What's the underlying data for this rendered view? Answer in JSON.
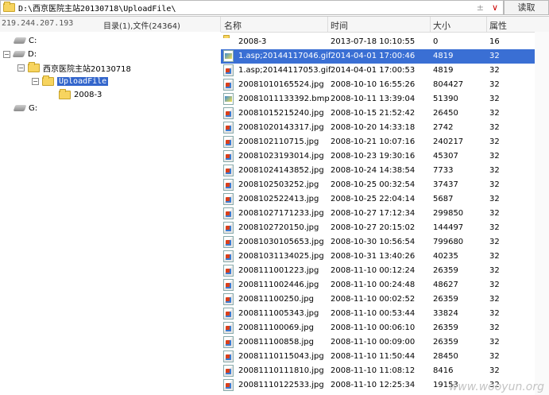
{
  "path_bar": {
    "path": "D:\\西京医院主站20130718\\UploadFile\\",
    "ctrl_plus": "±",
    "ctrl_dropdown": "∨",
    "read_button": "读取"
  },
  "status": {
    "ip": "219.244.207.193",
    "dir_info": "目录(1),文件(24364)"
  },
  "tree": {
    "nodes": [
      {
        "label": "C:",
        "type": "drive"
      },
      {
        "label": "D:",
        "type": "drive"
      },
      {
        "label": "西京医院主站20130718",
        "type": "folder"
      },
      {
        "label": "UploadFile",
        "type": "folder"
      },
      {
        "label": "2008-3",
        "type": "folder"
      },
      {
        "label": "G:",
        "type": "drive"
      }
    ],
    "expanders": [
      "⊟",
      "⊟",
      "⊟"
    ]
  },
  "file_list": {
    "columns": {
      "name": "名称",
      "time": "时间",
      "size": "大小",
      "attr": "属性"
    },
    "rows": [
      {
        "name": "2008-3",
        "time": "2013-07-18 10:10:55",
        "size": "0",
        "attr": "16",
        "icon": "folder"
      },
      {
        "name": "1.asp;20144117046.gif",
        "time": "2014-04-01 17:00:46",
        "size": "4819",
        "attr": "32",
        "icon": "bmp",
        "selected": true
      },
      {
        "name": "1.asp;20144117053.gif",
        "time": "2014-04-01 17:00:53",
        "size": "4819",
        "attr": "32",
        "icon": "image"
      },
      {
        "name": "20081010165524.jpg",
        "time": "2008-10-10 16:55:26",
        "size": "804427",
        "attr": "32",
        "icon": "image"
      },
      {
        "name": "20081011133392.bmp",
        "time": "2008-10-11 13:39:04",
        "size": "51390",
        "attr": "32",
        "icon": "bmp"
      },
      {
        "name": "20081015215240.jpg",
        "time": "2008-10-15 21:52:42",
        "size": "26450",
        "attr": "32",
        "icon": "image"
      },
      {
        "name": "20081020143317.jpg",
        "time": "2008-10-20 14:33:18",
        "size": "2742",
        "attr": "32",
        "icon": "image"
      },
      {
        "name": "2008102110715.jpg",
        "time": "2008-10-21 10:07:16",
        "size": "240217",
        "attr": "32",
        "icon": "image"
      },
      {
        "name": "20081023193014.jpg",
        "time": "2008-10-23 19:30:16",
        "size": "45307",
        "attr": "32",
        "icon": "image"
      },
      {
        "name": "20081024143852.jpg",
        "time": "2008-10-24 14:38:54",
        "size": "7733",
        "attr": "32",
        "icon": "image"
      },
      {
        "name": "2008102503252.jpg",
        "time": "2008-10-25 00:32:54",
        "size": "37437",
        "attr": "32",
        "icon": "image"
      },
      {
        "name": "2008102522413.jpg",
        "time": "2008-10-25 22:04:14",
        "size": "5687",
        "attr": "32",
        "icon": "image"
      },
      {
        "name": "20081027171233.jpg",
        "time": "2008-10-27 17:12:34",
        "size": "299850",
        "attr": "32",
        "icon": "image"
      },
      {
        "name": "2008102720150.jpg",
        "time": "2008-10-27 20:15:02",
        "size": "144497",
        "attr": "32",
        "icon": "image"
      },
      {
        "name": "20081030105653.jpg",
        "time": "2008-10-30 10:56:54",
        "size": "799680",
        "attr": "32",
        "icon": "image"
      },
      {
        "name": "20081031134025.jpg",
        "time": "2008-10-31 13:40:26",
        "size": "40235",
        "attr": "32",
        "icon": "image"
      },
      {
        "name": "2008111001223.jpg",
        "time": "2008-11-10 00:12:24",
        "size": "26359",
        "attr": "32",
        "icon": "image"
      },
      {
        "name": "2008111002446.jpg",
        "time": "2008-11-10 00:24:48",
        "size": "48627",
        "attr": "32",
        "icon": "image"
      },
      {
        "name": "200811100250.jpg",
        "time": "2008-11-10 00:02:52",
        "size": "26359",
        "attr": "32",
        "icon": "image"
      },
      {
        "name": "2008111005343.jpg",
        "time": "2008-11-10 00:53:44",
        "size": "33824",
        "attr": "32",
        "icon": "image"
      },
      {
        "name": "200811100069.jpg",
        "time": "2008-11-10 00:06:10",
        "size": "26359",
        "attr": "32",
        "icon": "image"
      },
      {
        "name": "200811100858.jpg",
        "time": "2008-11-10 00:09:00",
        "size": "26359",
        "attr": "32",
        "icon": "image"
      },
      {
        "name": "20081110115043.jpg",
        "time": "2008-11-10 11:50:44",
        "size": "28450",
        "attr": "32",
        "icon": "image"
      },
      {
        "name": "20081110111810.jpg",
        "time": "2008-11-10 11:08:12",
        "size": "8416",
        "attr": "32",
        "icon": "image"
      },
      {
        "name": "20081110122533.jpg",
        "time": "2008-11-10 12:25:34",
        "size": "19153",
        "attr": "32",
        "icon": "image"
      }
    ]
  },
  "watermark": "www.wooyun.org",
  "colors": {
    "selection": "#3a6fd4",
    "tree_selection": "#3366cc",
    "folder": "#f7d45f"
  }
}
